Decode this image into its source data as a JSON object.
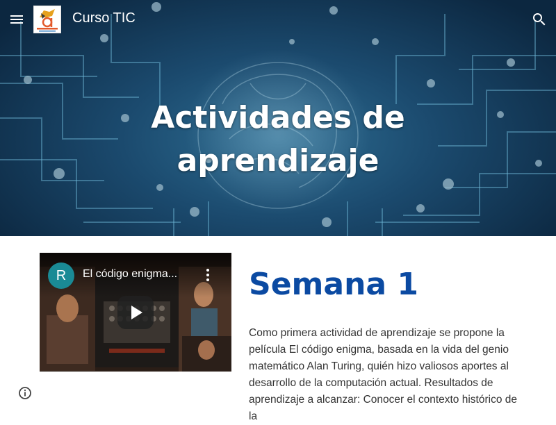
{
  "header": {
    "site_title": "Curso TIC",
    "logo_icon": "course-logo-icon",
    "menu_icon": "menu-icon",
    "search_icon": "search-icon"
  },
  "hero": {
    "title_line1": "Actividades de",
    "title_line2": "aprendizaje"
  },
  "video": {
    "channel_initial": "R",
    "title": "El código enigma...",
    "more_icon": "more-vert-icon",
    "play_icon": "play-icon"
  },
  "section": {
    "heading": "Semana 1",
    "paragraph": "Como primera actividad de aprendizaje se propone la película El código enigma, basada en la vida del genio matemático Alan Turing, quién hizo valiosos aportes al desarrollo de la computación actual. Resultados de aprendizaje a alcanzar: Conocer el contexto histórico de la"
  },
  "footer": {
    "info_icon": "info-icon"
  },
  "colors": {
    "heading": "#0b4aa2",
    "hero_dark": "#0c2740",
    "hero_mid": "#2e6e93",
    "avatar": "#1a8a95"
  }
}
